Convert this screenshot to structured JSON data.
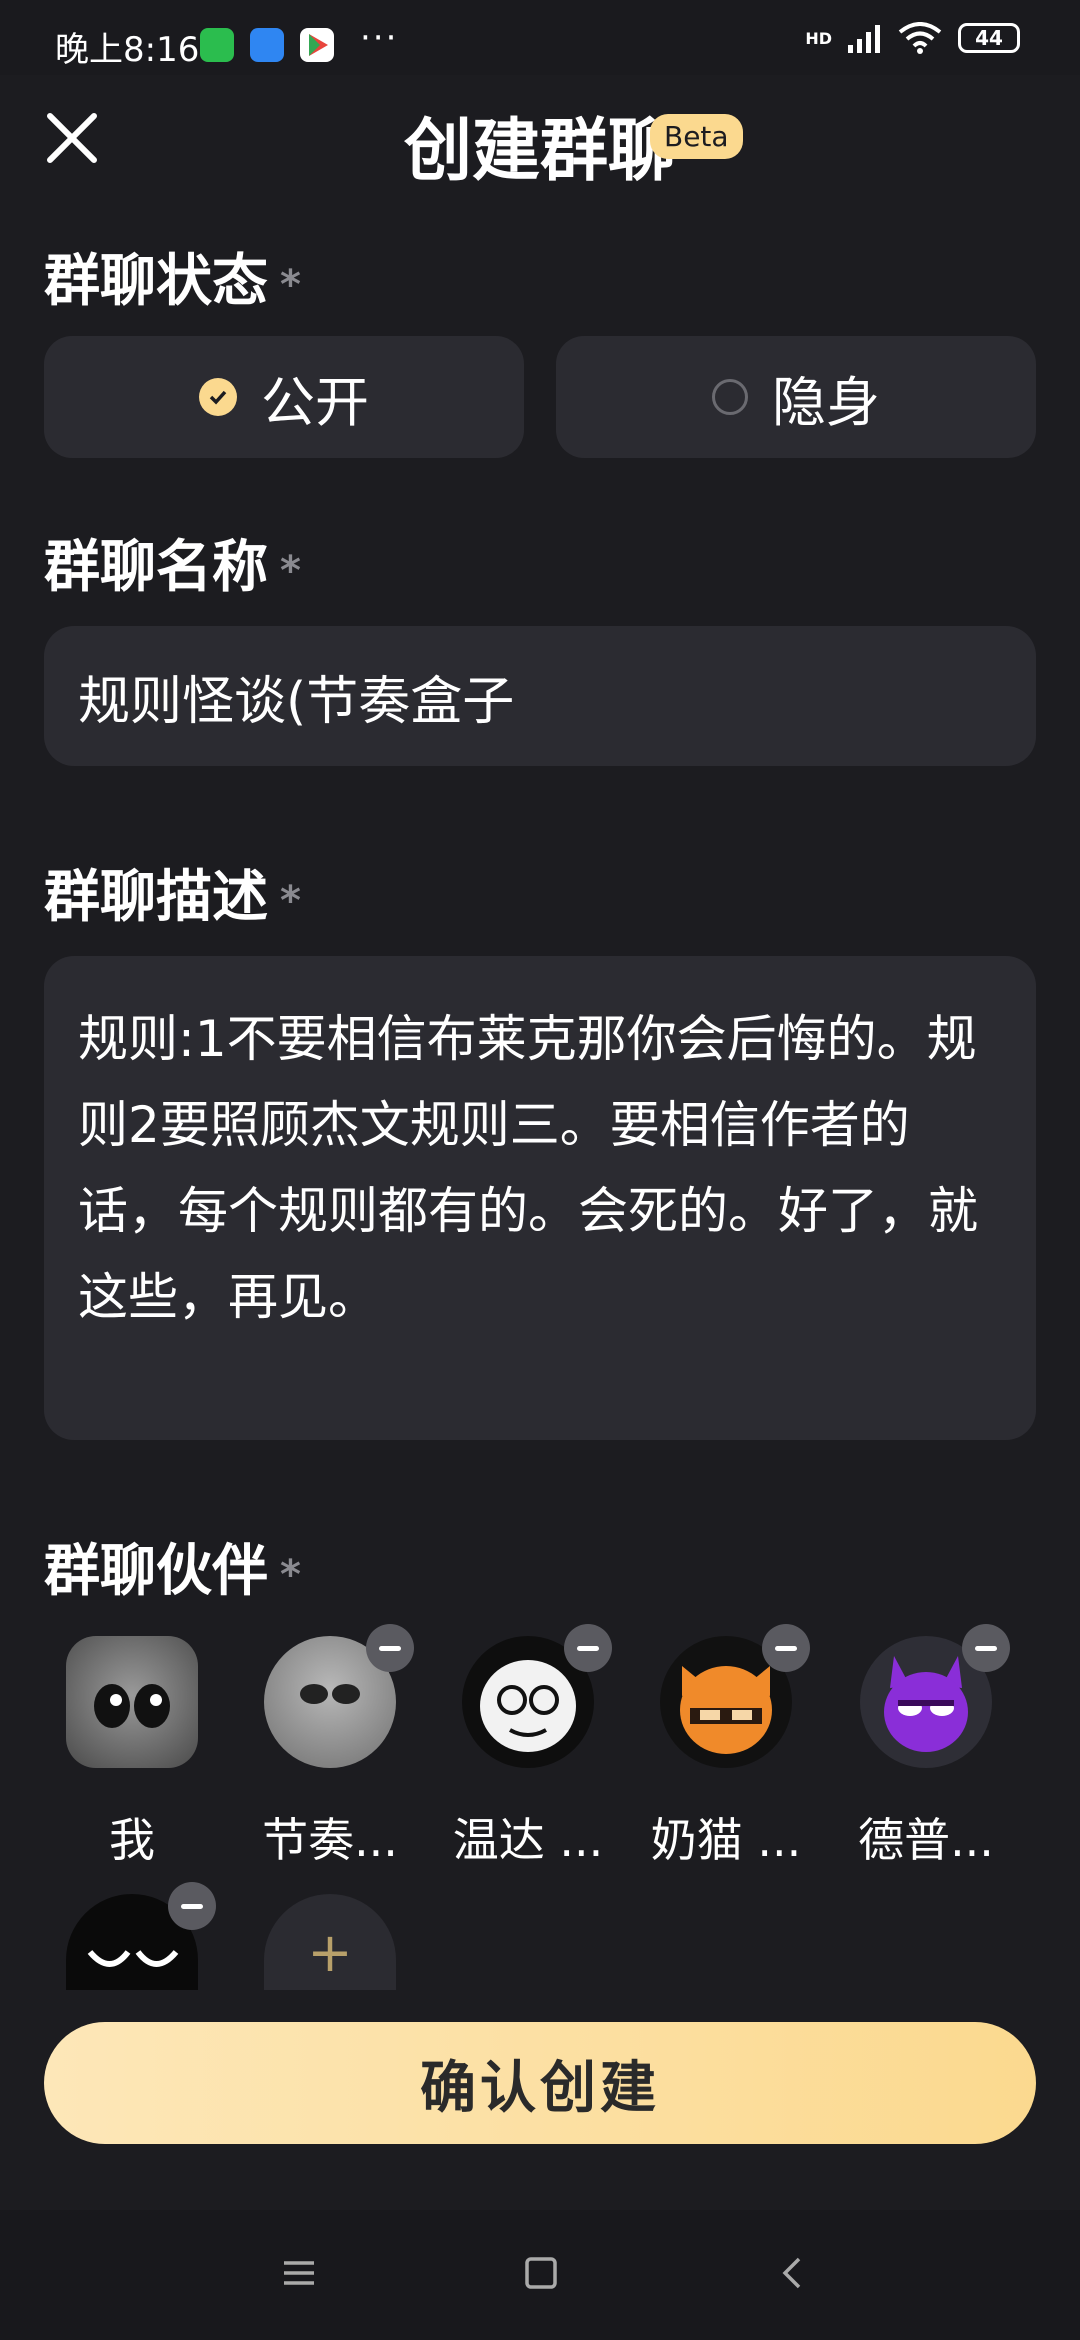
{
  "status_bar": {
    "time": "晚上8:16",
    "more": "···",
    "network": "HD",
    "battery": "44"
  },
  "header": {
    "title": "创建群聊",
    "badge": "Beta"
  },
  "status_section": {
    "label": "群聊状态",
    "required_mark": "*",
    "options": [
      {
        "label": "公开",
        "selected": true
      },
      {
        "label": "隐身",
        "selected": false
      }
    ]
  },
  "name_section": {
    "label": "群聊名称",
    "required_mark": "*",
    "value": "规则怪谈(节奏盒子"
  },
  "desc_section": {
    "label": "群聊描述",
    "required_mark": "*",
    "value": "规则:1不要相信布莱克那你会后悔的。规则2要照顾杰文规则三。要相信作者的话，每个规则都有的。会死的。好了，就这些，再见。"
  },
  "partners_section": {
    "label": "群聊伙伴",
    "required_mark": "*",
    "partners": [
      {
        "name": "我",
        "removable": false
      },
      {
        "name": "节奏...",
        "removable": true
      },
      {
        "name": "温达 ...",
        "removable": true
      },
      {
        "name": "奶猫 ...",
        "removable": true
      },
      {
        "name": "德普...",
        "removable": true
      },
      {
        "name": "",
        "removable": true
      }
    ],
    "add_label": "+"
  },
  "confirm_button": {
    "label": "确认创建"
  },
  "nav_bar": {
    "menu": "menu-icon",
    "home": "home-icon",
    "back": "back-icon"
  }
}
